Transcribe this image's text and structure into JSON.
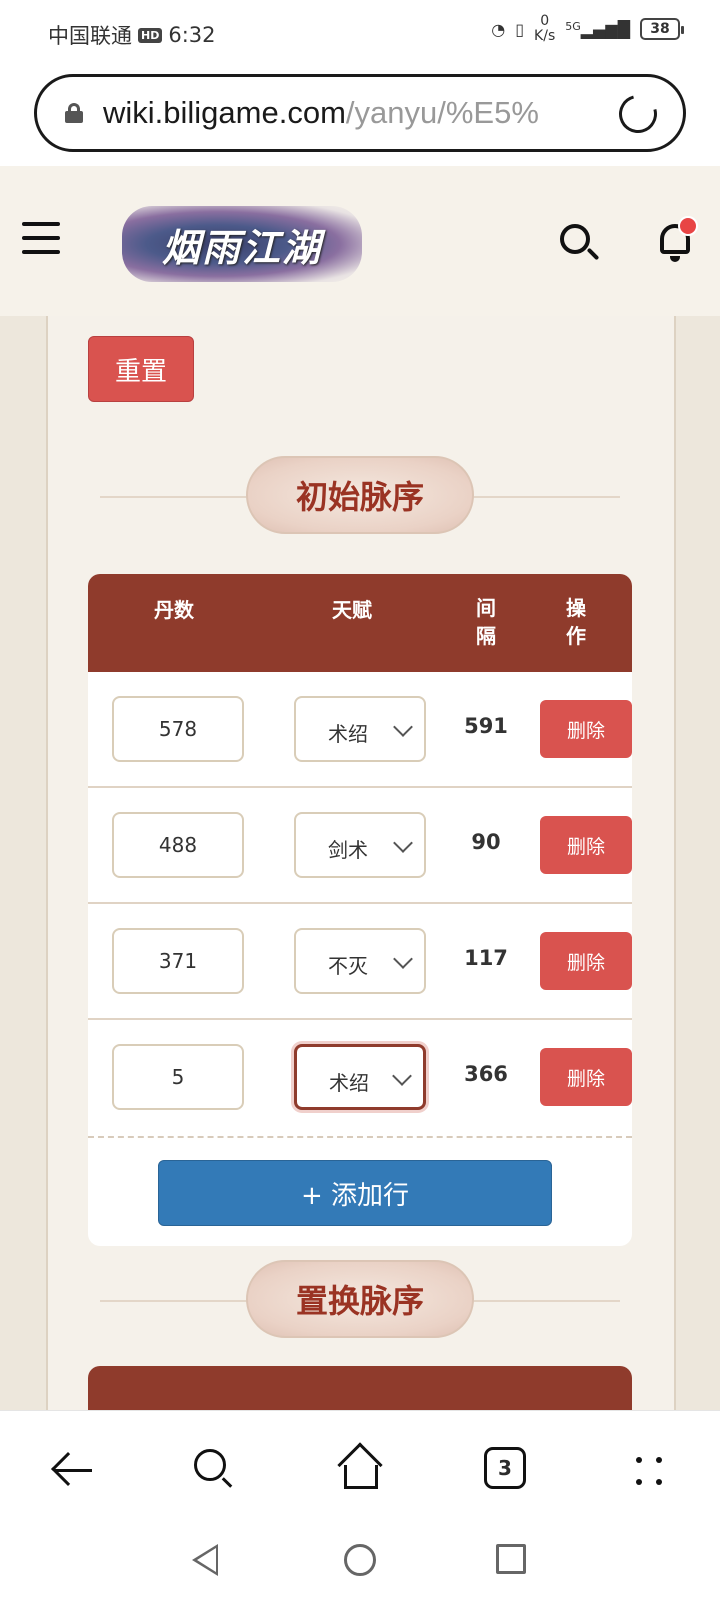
{
  "status_bar": {
    "carrier": "中国联通",
    "hd": "HD",
    "time": "6:32",
    "net_speed_value": "0",
    "net_speed_unit": "K/s",
    "signal": "5G",
    "battery": "38"
  },
  "url_bar": {
    "host": "wiki.biligame.com",
    "path": "/yanyu/%E5%"
  },
  "header": {
    "logo_text": "烟雨江湖"
  },
  "controls": {
    "reset_label": "重置"
  },
  "section1": {
    "title": "初始脉序",
    "columns": {
      "dan": "丹数",
      "talent": "天赋",
      "gap": "间隔",
      "action": "操作"
    },
    "rows": [
      {
        "dan": "578",
        "talent": "术绍",
        "gap": "591",
        "delete": "删除"
      },
      {
        "dan": "488",
        "talent": "剑术",
        "gap": "90",
        "delete": "删除"
      },
      {
        "dan": "371",
        "talent": "不灭",
        "gap": "117",
        "delete": "删除"
      },
      {
        "dan": "5",
        "talent": "术绍",
        "gap": "366",
        "delete": "删除"
      }
    ],
    "add_row_label": "+ 添加行"
  },
  "section2": {
    "title": "置换脉序"
  },
  "browser_nav": {
    "tab_count": "3"
  }
}
